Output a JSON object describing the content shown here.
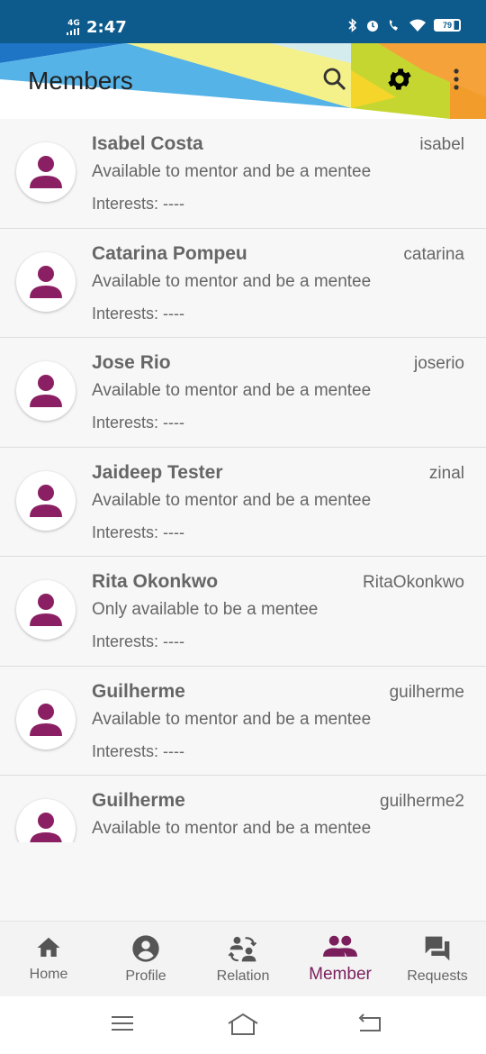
{
  "status": {
    "time": "2:47",
    "network": "4G",
    "battery": "79"
  },
  "app_bar": {
    "title": "Members",
    "search_icon": "search-icon",
    "settings_icon": "gear-icon",
    "more_icon": "more-vert-icon"
  },
  "members": [
    {
      "name": "Isabel Costa",
      "username": "isabel",
      "availability": "Available to mentor and be a mentee",
      "interests": "Interests: ----"
    },
    {
      "name": "Catarina Pompeu",
      "username": "catarina",
      "availability": "Available to mentor and be a mentee",
      "interests": "Interests: ----"
    },
    {
      "name": "Jose Rio",
      "username": "joserio",
      "availability": "Available to mentor and be a mentee",
      "interests": "Interests: ----"
    },
    {
      "name": "Jaideep Tester",
      "username": "zinal",
      "availability": "Available to mentor and be a mentee",
      "interests": "Interests: ----"
    },
    {
      "name": "Rita Okonkwo",
      "username": "RitaOkonkwo",
      "availability": "Only available to be a mentee",
      "interests": "Interests: ----"
    },
    {
      "name": "Guilherme",
      "username": "guilherme",
      "availability": "Available to mentor and be a mentee",
      "interests": "Interests: ----"
    },
    {
      "name": "Guilherme",
      "username": "guilherme2",
      "availability": "Available to mentor and be a mentee",
      "interests": ""
    }
  ],
  "bottom_nav": [
    {
      "label": "Home",
      "icon": "home-icon"
    },
    {
      "label": "Profile",
      "icon": "account-circle-icon"
    },
    {
      "label": "Relation",
      "icon": "relation-icon"
    },
    {
      "label": "Member",
      "icon": "people-icon",
      "active": true
    },
    {
      "label": "Requests",
      "icon": "forum-icon"
    }
  ],
  "colors": {
    "accent": "#7a1f5c",
    "status_bar": "#0d5a8c"
  }
}
